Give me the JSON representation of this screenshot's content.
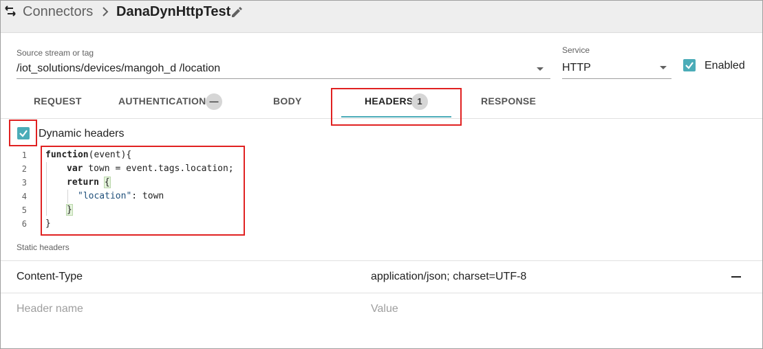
{
  "header": {
    "breadcrumb_root": "Connectors",
    "current": "DanaDynHttpTest"
  },
  "source": {
    "label": "Source stream or tag",
    "value": "/iot_solutions/devices/mangoh_d /location"
  },
  "service": {
    "label": "Service",
    "value": "HTTP"
  },
  "enabled": {
    "label": "Enabled",
    "checked": true
  },
  "tabs": [
    {
      "label": "REQUEST",
      "badge": ""
    },
    {
      "label": "AUTHENTICATION",
      "badge": "—"
    },
    {
      "label": "BODY",
      "badge": ""
    },
    {
      "label": "HEADERS",
      "badge": "1",
      "active": true
    },
    {
      "label": "RESPONSE",
      "badge": ""
    }
  ],
  "dynamic_headers": {
    "label": "Dynamic headers",
    "checked": true
  },
  "code": {
    "line_numbers": [
      "1",
      "2",
      "3",
      "4",
      "5",
      "6"
    ],
    "lines": [
      {
        "kw": "function",
        "text": "(event){"
      },
      {
        "kw": "var",
        "text": " town = event.tags.location;"
      },
      {
        "kw": "return",
        "text": " ",
        "brace": "{"
      },
      {
        "str": "\"location\"",
        "text": ": town"
      },
      {
        "brace": "}"
      },
      {
        "text": "}"
      }
    ]
  },
  "static_headers": {
    "label": "Static headers",
    "rows": [
      {
        "name": "Content-Type",
        "value": "application/json; charset=UTF-8"
      }
    ],
    "new_row": {
      "name_placeholder": "Header name",
      "value_placeholder": "Value"
    }
  },
  "colors": {
    "accent": "#4bacb8",
    "annotation_red": "#e02020"
  }
}
